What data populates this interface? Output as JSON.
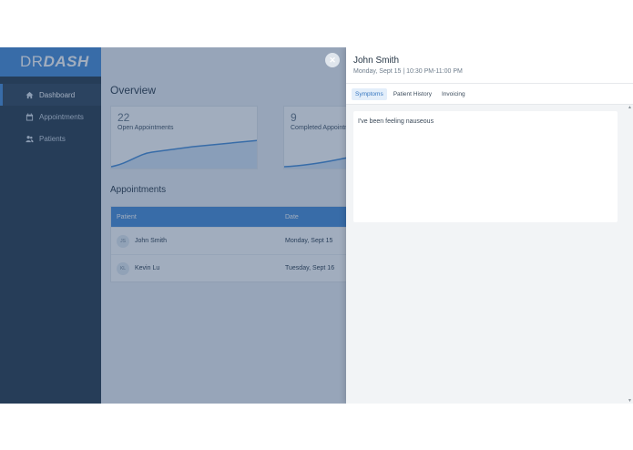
{
  "sidebar": {
    "logo_dr": "DR",
    "logo_dash": "DASH",
    "items": [
      {
        "label": "Dashboard",
        "icon": "home-icon"
      },
      {
        "label": "Appointments",
        "icon": "calendar-icon"
      },
      {
        "label": "Patients",
        "icon": "users-icon"
      }
    ]
  },
  "main": {
    "title": "Overview",
    "stats": [
      {
        "value": "22",
        "label": "Open Appointments"
      },
      {
        "value": "9",
        "label": "Completed Appointments"
      }
    ],
    "appointments_title": "Appointments",
    "table": {
      "headers": [
        "Patient",
        "Date"
      ],
      "rows": [
        {
          "initials": "JS",
          "name": "John Smith",
          "date": "Monday, Sept 15"
        },
        {
          "initials": "KL",
          "name": "Kevin Lu",
          "date": "Tuesday, Sept 16"
        }
      ]
    }
  },
  "panel": {
    "patient_name": "John Smith",
    "appointment_time": "Monday, Sept 15 | 10:30 PM-11:00 PM",
    "tabs": [
      "Symptoms",
      "Patient History",
      "Invoicing"
    ],
    "active_tab": "Symptoms",
    "symptoms_text": "I've been feeling nauseous"
  },
  "colors": {
    "accent": "#4a90d9",
    "sidebar": "#2c3e50",
    "active_tab_bg": "#e3eefa"
  }
}
